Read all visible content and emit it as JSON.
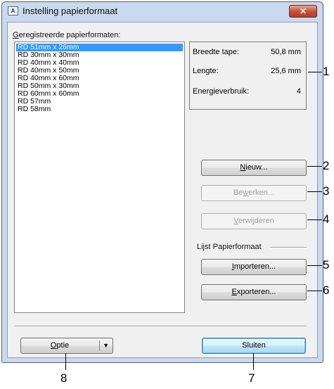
{
  "window": {
    "title": "Instelling papierformaat",
    "close_label": "✕"
  },
  "list_label_pre": "G",
  "list_label_rest": "eregistreerde papierformaten:",
  "formats": [
    "RD 51mm x 26mm",
    "RD 30mm x 30mm",
    "RD 40mm x 40mm",
    "RD 40mm x 50mm",
    "RD 40mm x 60mm",
    "RD 50mm x 30mm",
    "RD 60mm x 60mm",
    "RD 57mm",
    "RD 58mm"
  ],
  "info": [
    {
      "label": "Breedte tape:",
      "value": "50,8 mm"
    },
    {
      "label": "Lengte:",
      "value": "25,6 mm"
    },
    {
      "label": "Energieverbruik:",
      "value": "4"
    }
  ],
  "buttons": {
    "nieuw": {
      "pre": "",
      "u": "N",
      "post": "ieuw..."
    },
    "bewerken": {
      "pre": "Be",
      "u": "w",
      "post": "erken..."
    },
    "verwijderen": {
      "pre": "",
      "u": "V",
      "post": "erwijderen"
    },
    "importeren": {
      "pre": "",
      "u": "I",
      "post": "mporteren..."
    },
    "exporteren": {
      "pre": "",
      "u": "E",
      "post": "xporteren..."
    },
    "optie": {
      "pre": "",
      "u": "O",
      "post": "ptie"
    },
    "sluiten": "Sluiten"
  },
  "group_label": "Lijst Papierformaat",
  "callouts": [
    "1",
    "2",
    "3",
    "4",
    "5",
    "6",
    "7",
    "8"
  ]
}
